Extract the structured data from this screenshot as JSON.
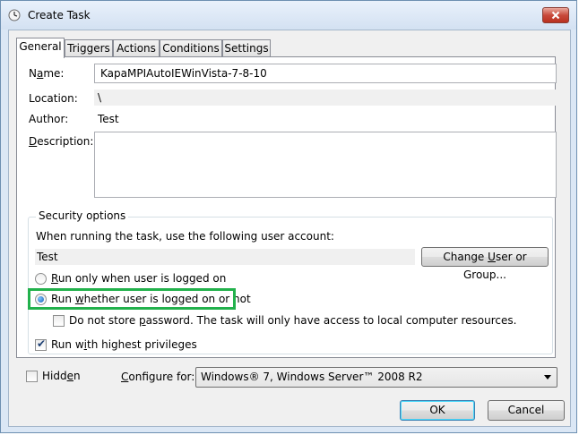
{
  "window": {
    "title": "Create Task",
    "close_symbol": "✕"
  },
  "tabs": [
    {
      "label": "General",
      "active": true
    },
    {
      "label": "Triggers"
    },
    {
      "label": "Actions"
    },
    {
      "label": "Conditions"
    },
    {
      "label": "Settings"
    }
  ],
  "general": {
    "name_label_pre": "N",
    "name_label_u": "a",
    "name_label_post": "me:",
    "name_value": "KapaMPIAutoIEWinVista-7-8-10",
    "location_label": "Location:",
    "location_value": "\\",
    "author_label": "Author:",
    "author_value": "Test",
    "description_label_u": "D",
    "description_label_post": "escription:",
    "description_value": ""
  },
  "security": {
    "title": "Security options",
    "account_prompt": "When running the task, use the following user account:",
    "account_value": "Test",
    "change_user_pre": "Change ",
    "change_user_u": "U",
    "change_user_post": "ser or Group...",
    "radio_logged_on_u": "R",
    "radio_logged_on_post": "un only when user is logged on",
    "radio_whether_pre": "Run ",
    "radio_whether_u": "w",
    "radio_whether_post": "hether user is logged on or not",
    "selected_option": "Run whether user is logged on or not",
    "no_store_pre": "Do not store ",
    "no_store_u": "p",
    "no_store_post": "assword.  The task will only have access to local computer resources.",
    "no_store_checked": false,
    "highest_pre": "Run w",
    "highest_u": "i",
    "highest_post": "th highest privileges",
    "highest_checked": true
  },
  "bottom": {
    "hidden_pre": "Hidd",
    "hidden_u": "e",
    "hidden_post": "n",
    "hidden_checked": false,
    "configure_pre": "",
    "configure_u": "C",
    "configure_post": "onfigure for:",
    "configure_value": "Windows® 7, Windows Server™ 2008 R2",
    "ok_label": "OK",
    "cancel_label": "Cancel"
  },
  "colors": {
    "highlight": "#22b14c",
    "title_bg": "#dbe7f5"
  }
}
